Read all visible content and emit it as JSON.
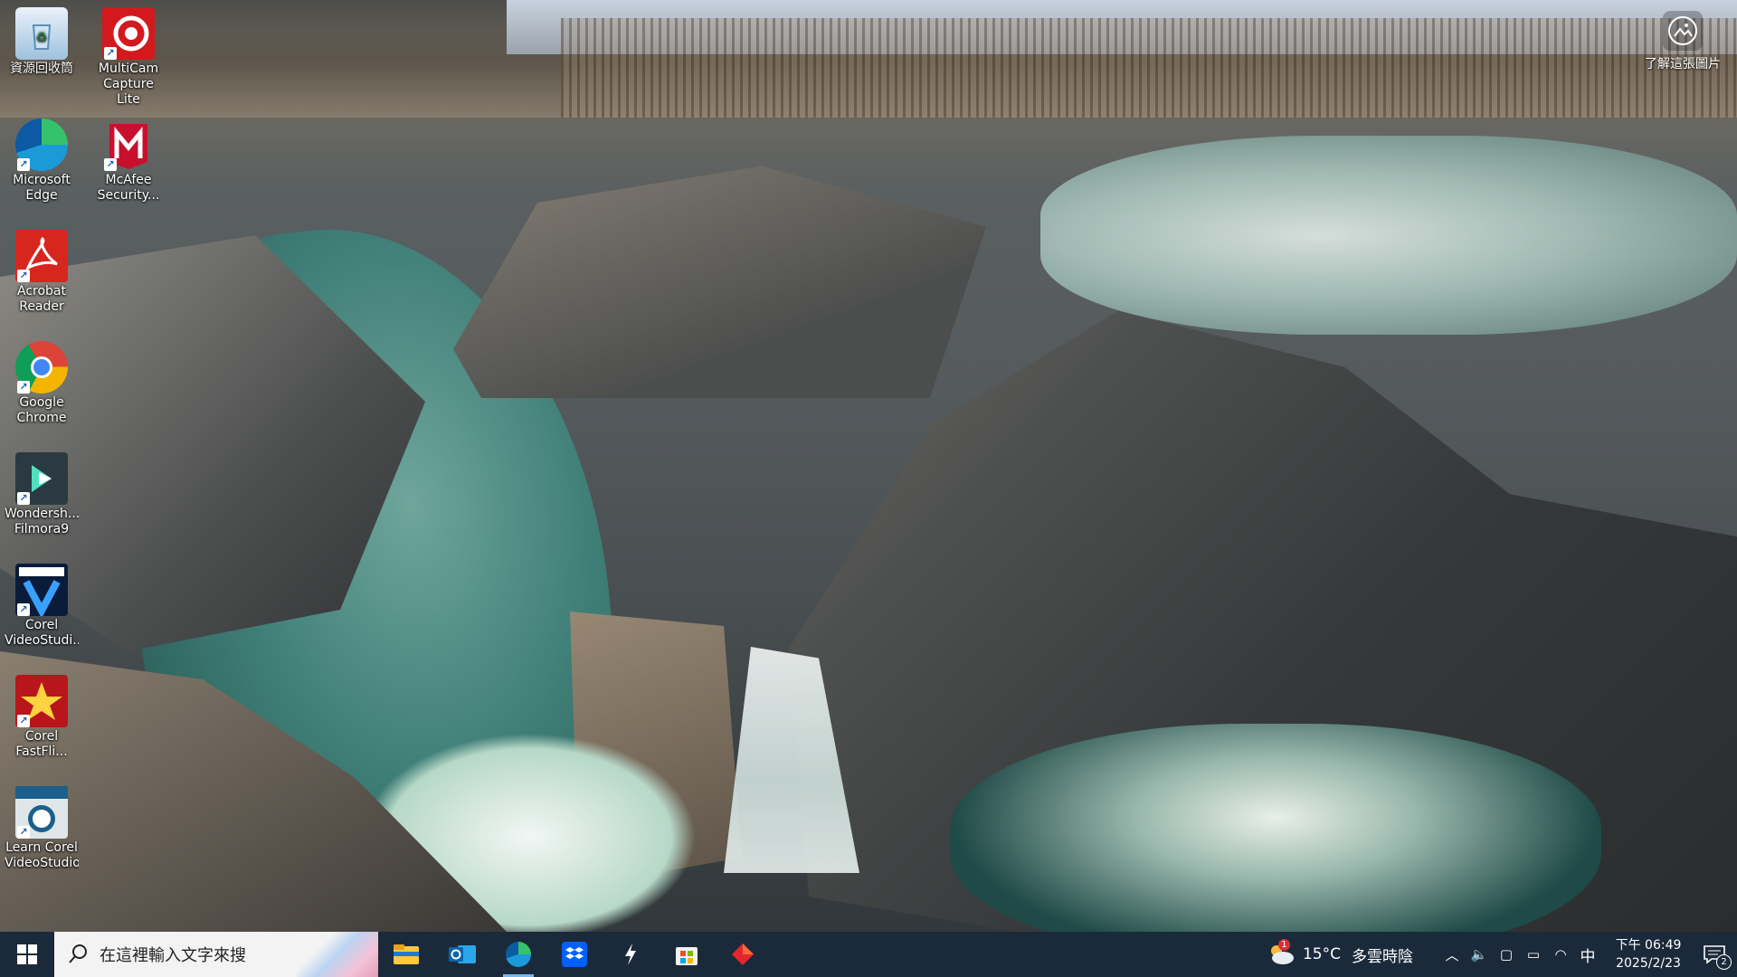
{
  "desktop": {
    "icons": [
      {
        "label": "資源回收筒",
        "icon": "recycle-bin-icon"
      },
      {
        "label": "MultiCam Capture Lite",
        "icon": "multicam-icon"
      },
      {
        "label": "Microsoft Edge",
        "icon": "edge-icon"
      },
      {
        "label": "McAfee Security...",
        "icon": "mcafee-icon"
      },
      {
        "label": "Acrobat Reader",
        "icon": "acrobat-icon"
      },
      {
        "label": "Google Chrome",
        "icon": "chrome-icon"
      },
      {
        "label": "Wondersh... Filmora9",
        "icon": "filmora-icon"
      },
      {
        "label": "Corel VideoStudi...",
        "icon": "corel-videostudio-icon"
      },
      {
        "label": "Corel FastFli...",
        "icon": "corel-fastflick-icon"
      },
      {
        "label": "Learn Corel VideoStudio",
        "icon": "learn-corel-icon"
      }
    ],
    "spotlight_label": "了解這張圖片"
  },
  "taskbar": {
    "search_placeholder": "在這裡輸入文字來搜",
    "apps": [
      "file-explorer",
      "outlook",
      "edge",
      "dropbox",
      "terminal-app",
      "microsoft-store",
      "app-red-diamond"
    ],
    "weather": {
      "temp": "15°C",
      "condition": "多雲時陰",
      "badge": "1"
    },
    "ime": "中",
    "clock": {
      "time": "下午 06:49",
      "date": "2025/2/23"
    },
    "notification_count": "2"
  },
  "colors": {
    "taskbar": "#1b2a3a",
    "accent": "#76b9ed"
  }
}
